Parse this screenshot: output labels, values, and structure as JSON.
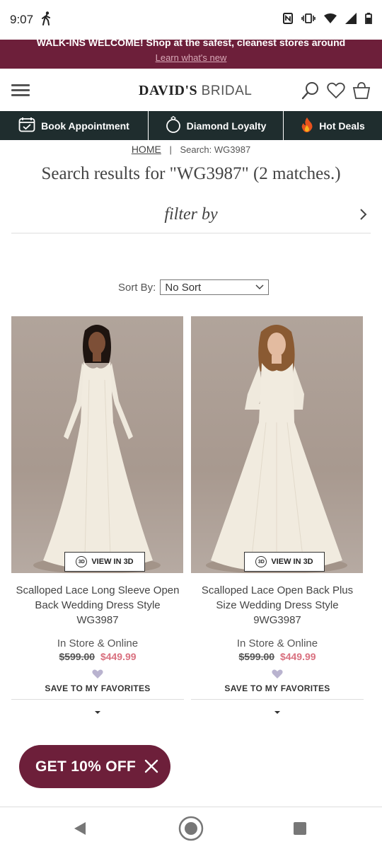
{
  "status_bar": {
    "time": "9:07"
  },
  "promo_banner": {
    "line1": "WALK-INS WELCOME! Shop at the safest, cleanest stores around",
    "line2": "Learn what's new"
  },
  "header": {
    "logo_bold": "DAVID'S",
    "logo_thin": "BRIDAL"
  },
  "nav": {
    "book": "Book Appointment",
    "loyalty": "Diamond Loyalty",
    "deals": "Hot Deals"
  },
  "breadcrumb": {
    "home": "HOME",
    "sep": "|",
    "current": "Search: WG3987"
  },
  "search": {
    "heading": "Search results for \"WG3987\" (2 matches.)"
  },
  "filter": {
    "label": "filter by"
  },
  "sort": {
    "label": "Sort By:",
    "selected": "No Sort"
  },
  "products": [
    {
      "name": "Scalloped Lace Long Sleeve Open Back Wedding Dress Style WG3987",
      "view3d": "VIEW IN 3D",
      "badge": "3D",
      "availability": "In Store & Online",
      "old_price": "$599.00",
      "new_price": "$449.99",
      "save_label": "SAVE TO MY FAVORITES"
    },
    {
      "name": "Scalloped Lace Open Back Plus Size Wedding Dress Style 9WG3987",
      "view3d": "VIEW IN 3D",
      "badge": "3D",
      "availability": "In Store & Online",
      "old_price": "$599.00",
      "new_price": "$449.99",
      "save_label": "SAVE TO MY FAVORITES"
    }
  ],
  "promo_pill": {
    "label": "GET 10% OFF"
  },
  "colors": {
    "brand": "#6d1f3a",
    "nav_bg": "#1f2d2e",
    "sale_price": "#d9707f",
    "heart": "#b9b3cf"
  }
}
